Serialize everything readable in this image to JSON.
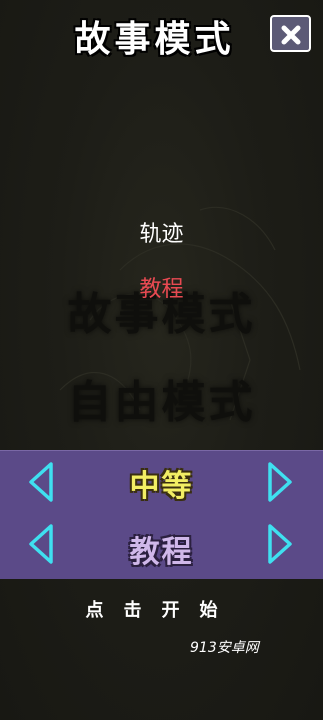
{
  "header": {
    "title": "故事模式",
    "close_icon": "close-x-icon"
  },
  "menu": {
    "items": [
      {
        "label": "轨迹",
        "color": "#ffffff"
      },
      {
        "label": "教程",
        "color": "#e84a52"
      }
    ]
  },
  "background_labels": {
    "story_mode": "故事模式",
    "free_mode": "自由模式"
  },
  "selectors": {
    "difficulty": {
      "value": "中等",
      "color": "#f2ee64"
    },
    "mode": {
      "value": "教程",
      "color": "#d0b8ea"
    },
    "arrow_color": "#3fe0f0",
    "panel_color": "#5b4a88"
  },
  "footer": {
    "start_label": "点击开始",
    "watermark": "913安卓网"
  }
}
